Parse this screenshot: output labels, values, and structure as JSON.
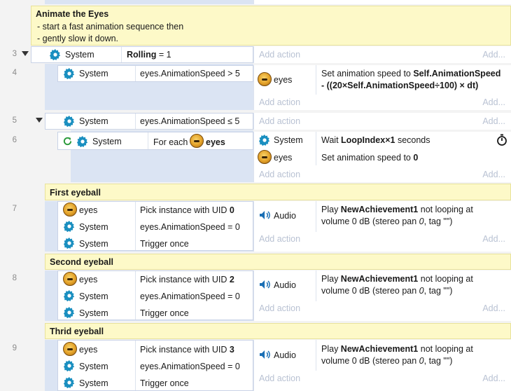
{
  "comment": {
    "title": "Animate the Eyes",
    "lines": [
      "- start a fast animation sequence then",
      "- gently slow it down."
    ]
  },
  "common": {
    "system": "System",
    "eyes": "eyes",
    "audio": "Audio",
    "add_action": "Add action",
    "add_short": "Add..."
  },
  "events": {
    "e3": {
      "num": "3",
      "cond_obj": "System",
      "cond_bold": "Rolling",
      "cond_rest": " = 1"
    },
    "e4": {
      "num": "4",
      "cond": "eyes.AnimationSpeed > 5",
      "action_line1_pre": "Set animation speed to ",
      "action_line1_bold": "Self.AnimationSpeed",
      "action_line2": "- ((20×Self.AnimationSpeed÷100) × dt)"
    },
    "e5": {
      "num": "5",
      "cond": "eyes.AnimationSpeed ≤ 5"
    },
    "e6": {
      "num": "6",
      "cond_pre": "For each",
      "cond_bold": "eyes",
      "act1_pre": "Wait ",
      "act1_bold": "LoopIndex×1",
      "act1_post": " seconds",
      "act2_pre": "Set animation speed to ",
      "act2_bold": "0"
    },
    "first": {
      "header": "First eyeball",
      "num": "7",
      "uid": "0"
    },
    "second": {
      "header": "Second eyeball",
      "num": "8",
      "uid": "2"
    },
    "third": {
      "header": "Thrid eyeball",
      "num": "9",
      "uid": "3"
    }
  },
  "eyeball_block": {
    "pick_pre": "Pick instance with UID ",
    "speed_cond": "eyes.AnimationSpeed = 0",
    "trigger": "Trigger once",
    "play_pre": "Play ",
    "play_bold": "NewAchievement1",
    "play_post": " not looping at",
    "play_line2_pre": "volume 0 dB (stereo pan ",
    "play_line2_pan": "0",
    "play_line2_post": ", tag \"\")"
  },
  "colors": {
    "comment_bg": "#fdf9c8",
    "condition_bg": "#dbe4f3",
    "gear": "#1a8fc0",
    "loop_icon": "#2a9a3a"
  }
}
